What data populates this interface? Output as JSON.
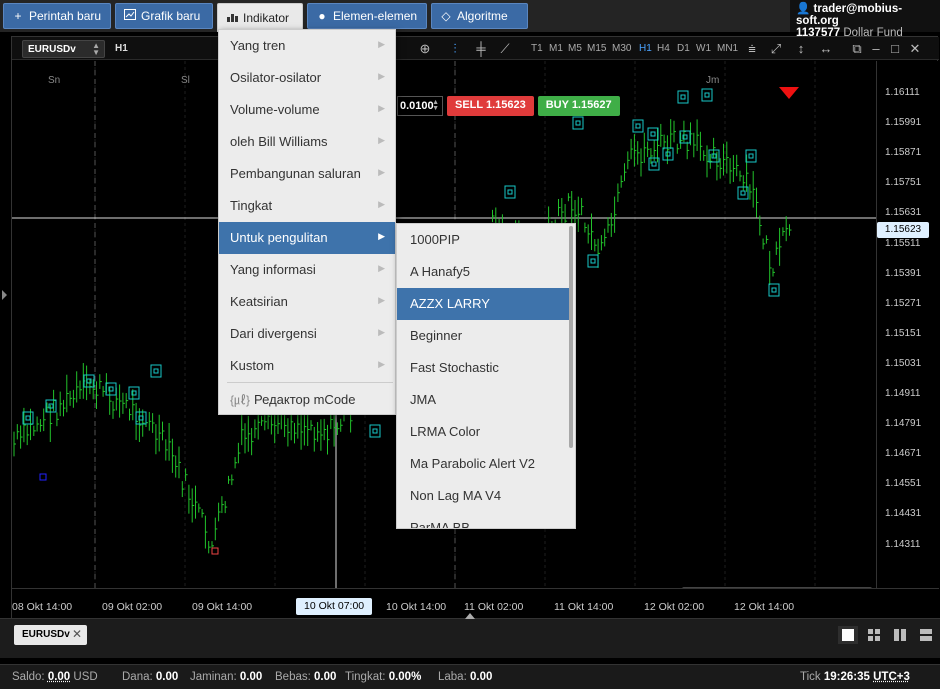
{
  "toolbar": {
    "new_order": "Perintah baru",
    "new_chart": "Grafik baru",
    "indicators": "Indikator",
    "elements": "Elemen-elemen",
    "algorithms": "Algoritme"
  },
  "account": {
    "user": "trader@mobius-soft.org",
    "number": "1137577",
    "fund": "Dollar Fund"
  },
  "chart": {
    "symbol": "EURUSDv",
    "timeframe": "H1",
    "timeframes": [
      "T1",
      "M1",
      "M5",
      "M15",
      "M30",
      "H1",
      "H4",
      "D1",
      "W1",
      "MN1"
    ],
    "selected_timeframe": "H1",
    "lot": "0.0100",
    "sell_label": "SELL 1.15623",
    "buy_label": "BUY 1.15627",
    "current_price": "1.15623",
    "price_ticks": [
      "1.16111",
      "1.15991",
      "1.15871",
      "1.15751",
      "1.15631",
      "1.15511",
      "1.15391",
      "1.15271",
      "1.15151",
      "1.15031",
      "1.14911",
      "1.14791",
      "1.14671",
      "1.14551",
      "1.14431",
      "1.14311"
    ],
    "time_ticks": [
      "08 Okt 14:00",
      "09 Okt 02:00",
      "09 Okt 14:00",
      "10 Okt 14:00",
      "11 Okt 02:00",
      "11 Okt 14:00",
      "12 Okt 02:00",
      "12 Okt 14:00"
    ],
    "crosshair_time": "10 Okt 07:00",
    "day_labels": [
      "Sn",
      "Sl",
      "Jm"
    ]
  },
  "indicator_menu": {
    "items": [
      {
        "label": "Yang tren",
        "has_sub": true
      },
      {
        "label": "Osilator-osilator",
        "has_sub": true
      },
      {
        "label": "Volume-volume",
        "has_sub": true
      },
      {
        "label": "oleh Bill Williams",
        "has_sub": true
      },
      {
        "label": "Pembangunan saluran",
        "has_sub": true
      },
      {
        "label": "Tingkat",
        "has_sub": true
      },
      {
        "label": "Untuk pengulitan",
        "has_sub": true,
        "active": true
      },
      {
        "label": "Yang informasi",
        "has_sub": true
      },
      {
        "label": "Keatsirian",
        "has_sub": true
      },
      {
        "label": "Dari divergensi",
        "has_sub": true
      },
      {
        "label": "Kustom",
        "has_sub": true
      }
    ],
    "mcode_editor": "Редактор mCode"
  },
  "submenu": {
    "items": [
      "1000PIP",
      "A Hanafy5",
      "AZZX LARRY",
      "Beginner",
      "Fast Stochastic",
      "JMA",
      "LRMA Color",
      "Ma Parabolic Alert V2",
      "Non Lag MA V4",
      "ParMA BB"
    ],
    "active": "AZZX LARRY"
  },
  "bottom": {
    "symbol_tab": "EURUSDv"
  },
  "status": {
    "saldo_label": "Saldo:",
    "saldo_value": "0.00",
    "saldo_currency": "USD",
    "dana_label": "Dana:",
    "dana_value": "0.00",
    "jaminan_label": "Jaminan:",
    "jaminan_value": "0.00",
    "bebas_label": "Bebas:",
    "bebas_value": "0.00",
    "tingkat_label": "Tingkat:",
    "tingkat_value": "0.00%",
    "laba_label": "Laba:",
    "laba_value": "0.00",
    "tick_label": "Tick",
    "tick_time": "19:26:35",
    "timezone": "UTC+3"
  },
  "colors": {
    "toolbar_blue": "#3b6aa5",
    "menu_active": "#3e73ab",
    "sell": "#e03b3b",
    "buy": "#3fae47",
    "candle": "#22c32b",
    "marker": "#17c7c7"
  }
}
